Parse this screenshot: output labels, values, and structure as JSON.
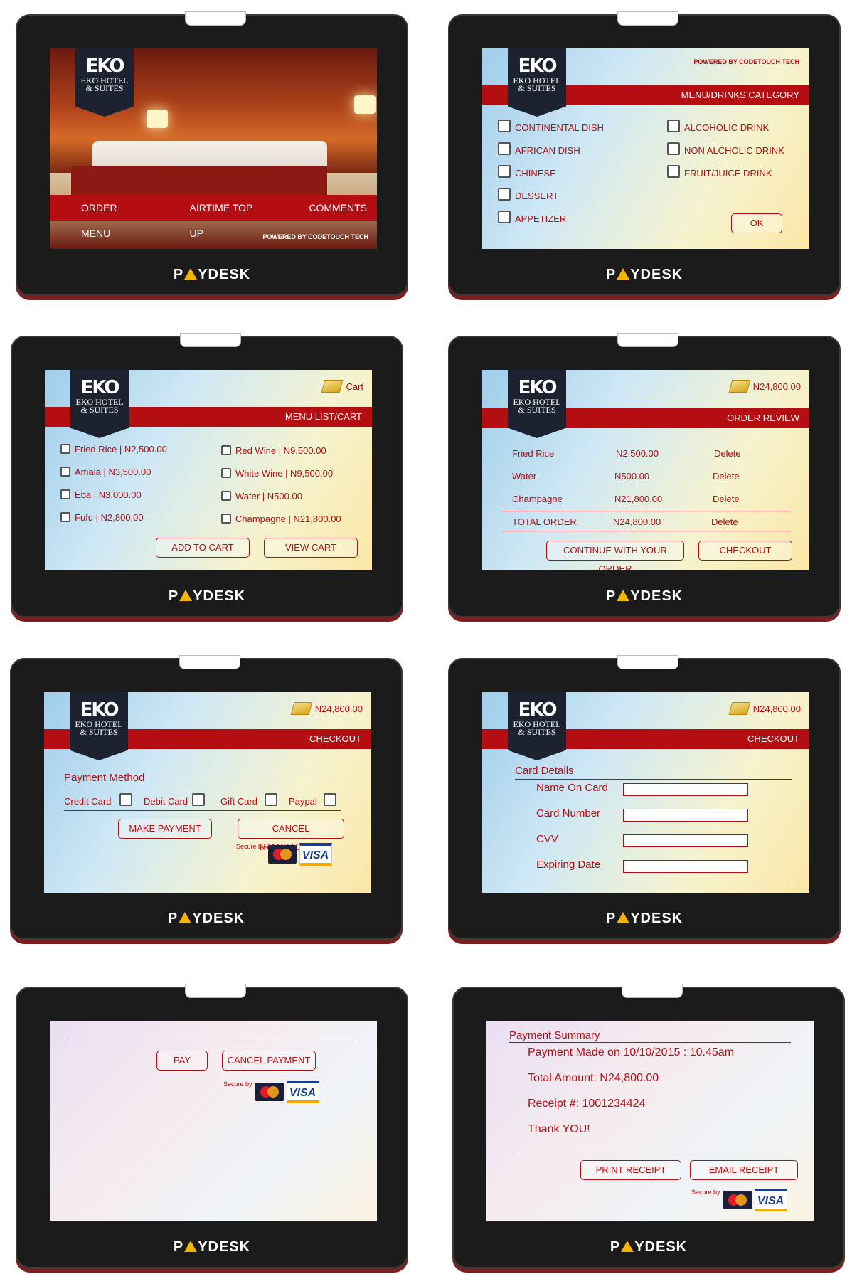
{
  "brand": {
    "pay": "P",
    "desk": "YDESK"
  },
  "logo": {
    "mark": "EKO",
    "line1": "EKO HOTEL",
    "line2": "& SUITES"
  },
  "screen1": {
    "menu": [
      "ORDER MENU",
      "AIRTIME TOP UP",
      "COMMENTS"
    ],
    "powered": "POWERED BY CODETOUCH TECH"
  },
  "screen2": {
    "powered": "POWERED BY CODETOUCH TECH",
    "title": "MENU/DRINKS  CATEGORY",
    "left": [
      "CONTINENTAL DISH",
      "AFRICAN DISH",
      "CHINESE",
      "DESSERT",
      "APPETIZER"
    ],
    "right": [
      "ALCOHOLIC DRINK",
      "NON ALCHOLIC DRINK",
      "FRUIT/JUICE DRINK"
    ],
    "ok": "OK"
  },
  "screen3": {
    "cart": "Cart",
    "title": "MENU LIST/CART",
    "left": [
      "Fried Rice  |  N2,500.00",
      "Amala  |  N3,500.00",
      "Eba  |  N3,000.00",
      "Fufu  |  N2,800.00"
    ],
    "right": [
      "Red Wine  |  N9,500.00",
      "White Wine  |  N9,500.00",
      "Water  |  N500.00",
      "Champagne  |  N21,800.00"
    ],
    "add": "ADD TO CART",
    "view": "VIEW CART"
  },
  "screen4": {
    "total": "N24,800.00",
    "title": "ORDER REVIEW",
    "rows": [
      {
        "item": "Fried Rice",
        "price": "N2,500.00",
        "action": "Delete"
      },
      {
        "item": "Water",
        "price": "N500.00",
        "action": "Delete"
      },
      {
        "item": "Champagne",
        "price": "N21,800.00",
        "action": "Delete"
      },
      {
        "item": "TOTAL ORDER",
        "price": "N24,800.00",
        "action": "Delete"
      }
    ],
    "continue": "CONTINUE WITH YOUR ORDER",
    "checkout": "CHECKOUT"
  },
  "screen5": {
    "total": "N24,800.00",
    "title": "CHECKOUT",
    "method": "Payment Method",
    "options": [
      "Credit Card",
      "Debit Card",
      "Gift Card",
      "Paypal"
    ],
    "make": "MAKE PAYMENT",
    "cancel": "CANCEL TRANSACTION",
    "secure": "Secure by",
    "visa": "VISA"
  },
  "screen6": {
    "total": "N24,800.00",
    "title": "CHECKOUT",
    "heading": "Card Details",
    "fields": [
      "Name  On Card",
      "Card Number",
      "CVV",
      "Expiring Date"
    ]
  },
  "screen7": {
    "pay": "PAY",
    "cancel": "CANCEL PAYMENT",
    "secure": "Secure by",
    "visa": "VISA"
  },
  "screen8": {
    "heading": "Payment Summary",
    "lines": [
      "Payment Made on 10/10/2015 : 10.45am",
      "Total Amount: N24,800.00",
      "Receipt #: 1001234424",
      "Thank YOU!"
    ],
    "print": "PRINT RECEIPT",
    "email": "EMAIL RECEIPT",
    "secure": "Secure by",
    "visa": "VISA"
  },
  "colors": {
    "accent": "#b40d12",
    "brand_yellow": "#f3b400",
    "bezel": "#1b1b1b"
  }
}
